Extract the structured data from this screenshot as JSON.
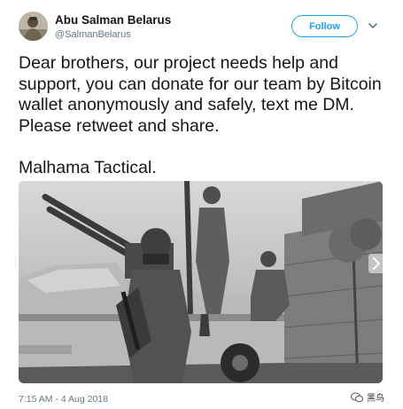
{
  "user": {
    "name": "Abu Salman Belarus",
    "handle": "@SalmanBelarus",
    "avatar_icon": "profile-photo"
  },
  "actions": {
    "follow_label": "Follow",
    "menu_icon": "chevron-down-icon"
  },
  "tweet": {
    "text": "Dear brothers, our project needs help and support, you can donate for our team by Bitcoin wallet anonymously and safely, text me DM. Please retweet and share.",
    "signature": "Malhama Tactical.",
    "timestamp": "7:15 AM - 4 Aug 2018"
  },
  "media": {
    "type": "photo",
    "next_icon": "chevron-right-icon"
  },
  "watermark": {
    "text": "黑鸟",
    "icon": "wechat-icon"
  },
  "colors": {
    "accent": "#1da1f2",
    "text": "#14171a",
    "muted": "#657786"
  }
}
